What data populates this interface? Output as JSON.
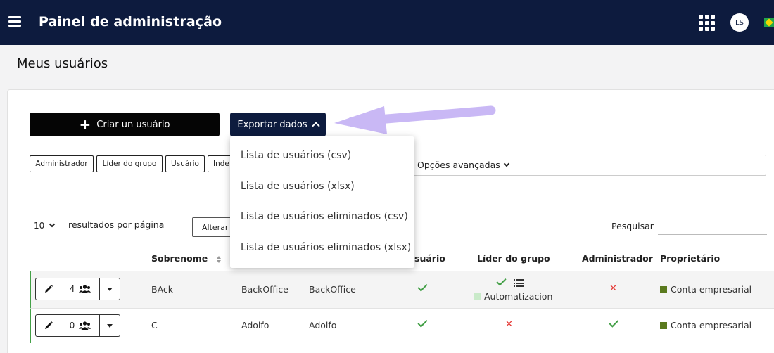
{
  "header": {
    "title": "Painel de administração",
    "avatar_initials": "LS",
    "icons": [
      "hamburger-menu-icon",
      "apps-grid-icon",
      "brazil-flag-icon"
    ]
  },
  "page": {
    "title": "Meus usuários"
  },
  "toolbar": {
    "create_label": "Criar un usuário",
    "export_label": "Exportar dados"
  },
  "export_menu": {
    "items": [
      "Lista de usuários (csv)",
      "Lista de usuários (xlsx)",
      "Lista de usuários eliminados (csv)",
      "Lista de usuários eliminados (xlsx)"
    ]
  },
  "filters": {
    "chips": [
      "Administrador",
      "Líder do grupo",
      "Usuário",
      "Inde"
    ],
    "advanced_label": "Opções avançadas"
  },
  "table_controls": {
    "per_page_value": "10",
    "per_page_label": "resultados por página",
    "alter_label": "Alterar c",
    "search_label": "Pesquisar"
  },
  "table": {
    "columns": {
      "surname": "Sobrenome",
      "user": "suário",
      "group_leader": "Líder do grupo",
      "administrator": "Administrador",
      "owner": "Proprietário"
    },
    "rows": [
      {
        "groups_count": "4",
        "surname": "BAck",
        "first_name": "BackOffice",
        "username": "BackOffice",
        "is_user": true,
        "group_leader": true,
        "group_name": "Automatizacion",
        "is_admin": false,
        "owner": "Conta empresarial"
      },
      {
        "groups_count": "0",
        "surname": "C",
        "first_name": "Adolfo",
        "username": "Adolfo",
        "is_user": true,
        "group_leader": false,
        "group_name": "",
        "is_admin": true,
        "owner": "Conta empresarial"
      }
    ]
  },
  "colors": {
    "header_bg": "#0d1b3e",
    "create_button_bg": "#050505",
    "check": "#43a047",
    "cross": "#e53935",
    "owner_square": "#5a7a1e",
    "group_square": "#c9eac9",
    "annotation_arrow": "#c9b8f5"
  }
}
